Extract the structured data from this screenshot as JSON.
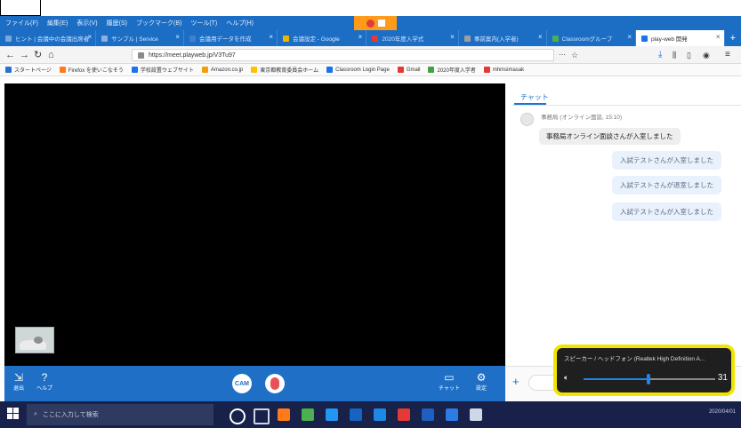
{
  "menu": [
    "ファイル(F)",
    "編集(E)",
    "表示(V)",
    "履歴(S)",
    "ブックマーク(B)",
    "ツール(T)",
    "ヘルプ(H)"
  ],
  "tabs": [
    {
      "label": "ヒント | 会議中の会議出席者",
      "color": "#7aa7d9",
      "active": false
    },
    {
      "label": "サンプル | Service",
      "color": "#8bb0dc",
      "active": false
    },
    {
      "label": "会議用データを作成",
      "color": "#3e7fd1",
      "active": false
    },
    {
      "label": "会議設定 - Google",
      "color": "#f0b400",
      "active": false
    },
    {
      "label": "2020年度入学式",
      "color": "#e53935",
      "active": false
    },
    {
      "label": "事前案内(入学者)",
      "color": "#9e9e9e",
      "active": false
    },
    {
      "label": "Classroomグループ",
      "color": "#4caf50",
      "active": false
    },
    {
      "label": "play-web 開発",
      "color": "#1a73e8",
      "active": true
    }
  ],
  "url": "https://meet.playweb.jp/V3Tu97",
  "bookmarks": [
    {
      "label": "スタートページ",
      "color": "#2b6fd0"
    },
    {
      "label": "Firefox を使いこなそう",
      "color": "#ff7a1a"
    },
    {
      "label": "学校設置ウェブサイト",
      "color": "#1a73e8"
    },
    {
      "label": "Amazon.co.jp",
      "color": "#f59e0b"
    },
    {
      "label": "東京都教育委員会ホーム",
      "color": "#ffc107"
    },
    {
      "label": "Classroom Login Page",
      "color": "#1a73e8"
    },
    {
      "label": "Gmail",
      "color": "#e53935"
    },
    {
      "label": "2020年度入学者",
      "color": "#43a047"
    },
    {
      "label": "mhmsimasak",
      "color": "#e53935"
    }
  ],
  "chat": {
    "tab_label": "チャット",
    "sender": "事務局 (オンライン面談, 15:10)",
    "incoming": "事務局オンライン面談さんが入室しました",
    "outgoing": [
      "入試テストさんが入室しました",
      "入試テストさんが退室しました",
      "入試テストさんが入室しました"
    ]
  },
  "controls": {
    "leave_label": "退出",
    "help_label": "ヘルプ",
    "camera_label": "CAM",
    "chat_label": "チャット",
    "settings_label": "設定"
  },
  "taskbar": {
    "search_placeholder": "ここに入力して検索",
    "apps": [
      {
        "name": "cortana-icon",
        "color": "#ffffff"
      },
      {
        "name": "taskview-icon",
        "color": "#cfd6e8"
      },
      {
        "name": "firefox-icon",
        "color": "#ff7a1a"
      },
      {
        "name": "chrome-icon",
        "color": "#4caf50"
      },
      {
        "name": "edge-icon",
        "color": "#2196f3"
      },
      {
        "name": "mail-icon",
        "color": "#1565c0"
      },
      {
        "name": "store-icon",
        "color": "#1e88e5"
      },
      {
        "name": "acrobat-icon",
        "color": "#e53935"
      },
      {
        "name": "word-icon",
        "color": "#1e5fbf"
      },
      {
        "name": "app-icon",
        "color": "#2d7be5"
      },
      {
        "name": "settings-icon",
        "color": "#cfd6e8"
      }
    ],
    "date": "2020/04/01"
  },
  "volume": {
    "device": "スピーカー / ヘッドフォン (Realtek High Definition A...",
    "value": "31",
    "level": 0.31,
    "accent": "#1f86e8",
    "highlight": "#f3e400"
  }
}
